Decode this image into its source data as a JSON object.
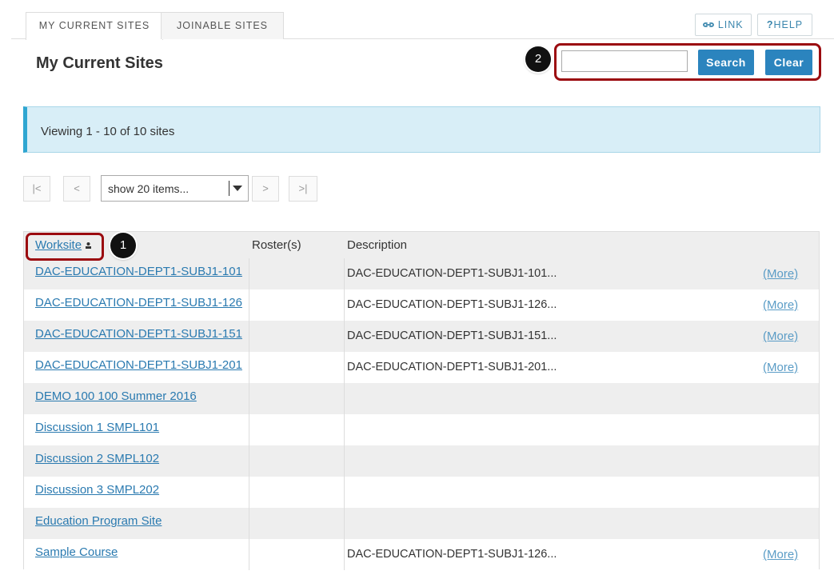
{
  "tabs": [
    {
      "label": "MY CURRENT SITES",
      "active": true
    },
    {
      "label": "JOINABLE SITES",
      "active": false
    }
  ],
  "toolbar": {
    "link_label": "LINK",
    "help_label": "HELP",
    "link_icon": "link-icon",
    "help_icon": "question-icon"
  },
  "page_title": "My Current Sites",
  "search": {
    "value": "",
    "placeholder": "",
    "search_label": "Search",
    "clear_label": "Clear"
  },
  "callouts": {
    "one": "1",
    "two": "2"
  },
  "info": {
    "text": "Viewing 1 - 10 of 10 sites"
  },
  "pager": {
    "first": "|<",
    "prev": "<",
    "next": ">",
    "last": ">|",
    "page_size": "show 20 items..."
  },
  "table": {
    "headers": {
      "worksite": "Worksite",
      "roster": "Roster(s)",
      "description": "Description"
    },
    "more_label": "(More)",
    "rows": [
      {
        "site": "DAC-EDUCATION-DEPT1-SUBJ1-101",
        "description": "DAC-EDUCATION-DEPT1-SUBJ1-101...",
        "more": "(More)"
      },
      {
        "site": "DAC-EDUCATION-DEPT1-SUBJ1-126",
        "description": "DAC-EDUCATION-DEPT1-SUBJ1-126...",
        "more": "(More)"
      },
      {
        "site": "DAC-EDUCATION-DEPT1-SUBJ1-151",
        "description": "DAC-EDUCATION-DEPT1-SUBJ1-151...",
        "more": "(More)"
      },
      {
        "site": "DAC-EDUCATION-DEPT1-SUBJ1-201",
        "description": "DAC-EDUCATION-DEPT1-SUBJ1-201...",
        "more": "(More)"
      },
      {
        "site": "DEMO 100 100 Summer 2016",
        "description": "",
        "more": ""
      },
      {
        "site": "Discussion 1 SMPL101",
        "description": "",
        "more": ""
      },
      {
        "site": "Discussion 2 SMPL102",
        "description": "",
        "more": ""
      },
      {
        "site": "Discussion 3 SMPL202",
        "description": "",
        "more": ""
      },
      {
        "site": "Education Program Site",
        "description": "",
        "more": ""
      },
      {
        "site": "Sample Course",
        "description": "DAC-EDUCATION-DEPT1-SUBJ1-126...",
        "more": "(More)"
      }
    ]
  },
  "colors": {
    "accent": "#2b84be",
    "link": "#2a7ab0",
    "highlight": "#9b0b10",
    "info_bg": "#d8eef7"
  }
}
